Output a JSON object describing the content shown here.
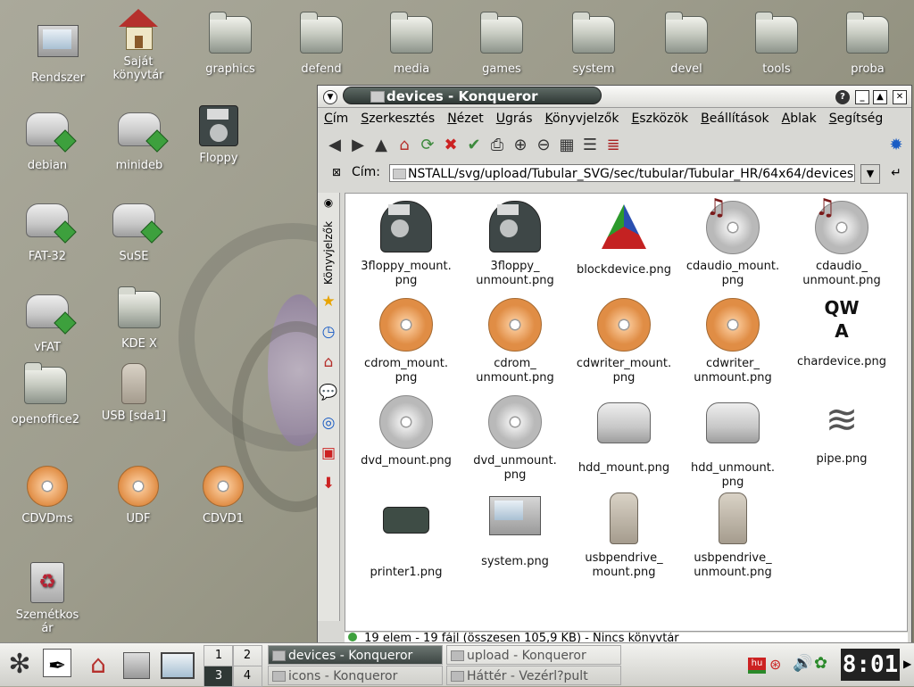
{
  "desktop": {
    "icons": [
      {
        "label": "Rendszer",
        "icon": "computer-icon"
      },
      {
        "label": "Saját\nkönyvtár",
        "icon": "home-icon"
      },
      {
        "label": "graphics",
        "icon": "folder-icon"
      },
      {
        "label": "defend",
        "icon": "folder-icon"
      },
      {
        "label": "media",
        "icon": "folder-icon"
      },
      {
        "label": "games",
        "icon": "folder-icon"
      },
      {
        "label": "system",
        "icon": "folder-icon"
      },
      {
        "label": "devel",
        "icon": "folder-icon"
      },
      {
        "label": "tools",
        "icon": "folder-icon"
      },
      {
        "label": "proba",
        "icon": "folder-icon"
      },
      {
        "label": "debian",
        "icon": "hdd-icon"
      },
      {
        "label": "minideb",
        "icon": "hdd-icon"
      },
      {
        "label": "Floppy",
        "icon": "floppy-icon"
      },
      {
        "label": "FAT-32",
        "icon": "hdd-icon"
      },
      {
        "label": "SuSE",
        "icon": "hdd-icon"
      },
      {
        "label": "vFAT",
        "icon": "hdd-icon"
      },
      {
        "label": "KDE X",
        "icon": "folder-icon"
      },
      {
        "label": "openoffice2",
        "icon": "folder-icon"
      },
      {
        "label": "USB [sda1]",
        "icon": "usb-icon"
      },
      {
        "label": "CDVDms",
        "icon": "cdrom-icon"
      },
      {
        "label": "UDF",
        "icon": "cdrom-icon"
      },
      {
        "label": "CDVD1",
        "icon": "cdrom-icon"
      },
      {
        "label": "Szemétkos\nár",
        "icon": "trash-icon"
      }
    ]
  },
  "window": {
    "title": "devices - Konqueror",
    "menu": [
      "Cím",
      "Szerkesztés",
      "Nézet",
      "Ugrás",
      "Könyvjelzők",
      "Eszközök",
      "Beállítások",
      "Ablak",
      "Segítség"
    ],
    "location_label": "Cím:",
    "location_value": "NSTALL/svg/upload/Tubular_SVG/sec/tubular/Tubular_HR/64x64/devices",
    "sidebar_tab": "Könyvjelzők",
    "files": [
      {
        "name": "3floppy_mount.\npng",
        "icon": "floppy"
      },
      {
        "name": "3floppy_\nunmount.png",
        "icon": "floppy"
      },
      {
        "name": "blockdevice.png",
        "icon": "block"
      },
      {
        "name": "cdaudio_mount.\npng",
        "icon": "cdaudio"
      },
      {
        "name": "cdaudio_\nunmount.png",
        "icon": "cdaudio"
      },
      {
        "name": "cdrom_mount.\npng",
        "icon": "cd"
      },
      {
        "name": "cdrom_\nunmount.png",
        "icon": "cd"
      },
      {
        "name": "cdwriter_mount.\npng",
        "icon": "cdw"
      },
      {
        "name": "cdwriter_\nunmount.png",
        "icon": "cdw"
      },
      {
        "name": "chardevice.png",
        "icon": "char"
      },
      {
        "name": "dvd_mount.png",
        "icon": "dvd"
      },
      {
        "name": "dvd_unmount.\npng",
        "icon": "dvd"
      },
      {
        "name": "hdd_mount.png",
        "icon": "hdd"
      },
      {
        "name": "hdd_unmount.\npng",
        "icon": "hdd"
      },
      {
        "name": "pipe.png",
        "icon": "pipe"
      },
      {
        "name": "printer1.png",
        "icon": "printer"
      },
      {
        "name": "system.png",
        "icon": "system"
      },
      {
        "name": "usbpendrive_\nmount.png",
        "icon": "usb"
      },
      {
        "name": "usbpendrive_\nunmount.png",
        "icon": "usb"
      }
    ],
    "status": "19 elem - 19 fájl (összesen 105,9 KB) - Nincs könyvtár"
  },
  "taskbar": {
    "pager": [
      "1",
      "2",
      "3",
      "4"
    ],
    "tasks": [
      {
        "label": "devices - Konqueror",
        "active": true
      },
      {
        "label": "upload - Konqueror",
        "active": false
      },
      {
        "label": "icons - Konqueror",
        "active": false
      },
      {
        "label": "Háttér - Vezérl?pult",
        "active": false
      }
    ],
    "keyboard_layout": "hu",
    "clock": "8:01"
  },
  "colors": {
    "accent": "#3da03d",
    "title_pill": "#3d4643",
    "cd_orange": "#e08d45"
  }
}
